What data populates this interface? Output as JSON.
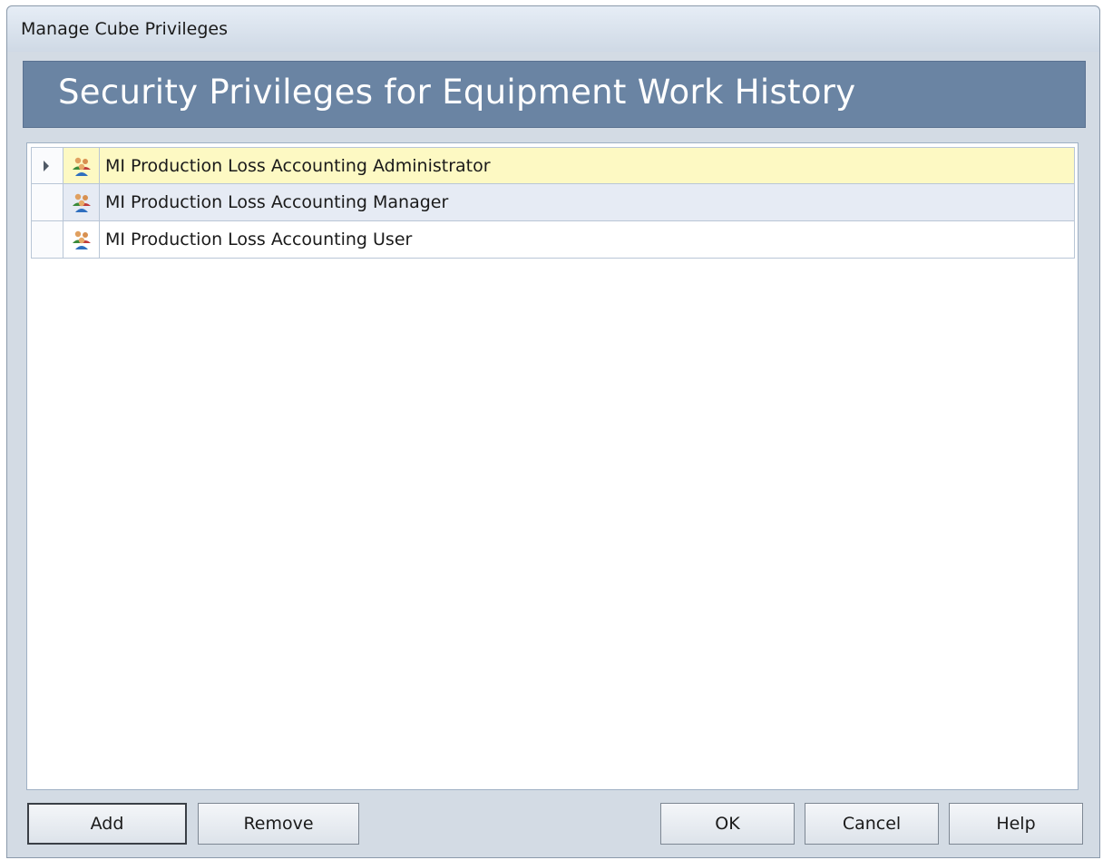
{
  "window": {
    "title": "Manage Cube Privileges"
  },
  "header": {
    "title": "Security Privileges for Equipment Work History"
  },
  "grid": {
    "rows": [
      {
        "label": "MI Production Loss Accounting Administrator",
        "icon": "user-group-icon",
        "selected": true
      },
      {
        "label": "MI Production Loss Accounting Manager",
        "icon": "user-group-icon",
        "selected": false
      },
      {
        "label": "MI Production Loss Accounting User",
        "icon": "user-group-icon",
        "selected": false
      }
    ]
  },
  "buttons": {
    "add": "Add",
    "remove": "Remove",
    "ok": "OK",
    "cancel": "Cancel",
    "help": "Help"
  },
  "colors": {
    "header_banner": "#6a84a3",
    "selected_row": "#fdf9c3",
    "alternate_row": "#e6ebf4"
  }
}
